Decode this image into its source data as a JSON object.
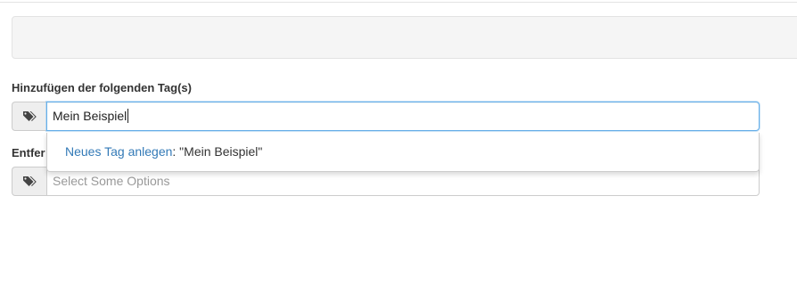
{
  "add_tags": {
    "label": "Hinzufügen der folgenden Tag(s)",
    "input_value": "Mein Beispiel",
    "icon": "tags-icon"
  },
  "dropdown": {
    "create_link": "Neues Tag anlegen",
    "create_suffix": ": \"Mein Beispiel\""
  },
  "remove_tags": {
    "label_visible": "Entfer",
    "placeholder": "Select Some Options",
    "icon": "tags-icon"
  },
  "colors": {
    "focus_border": "#66afe9",
    "link": "#337ab7",
    "addon_bg": "#eeeeee"
  }
}
